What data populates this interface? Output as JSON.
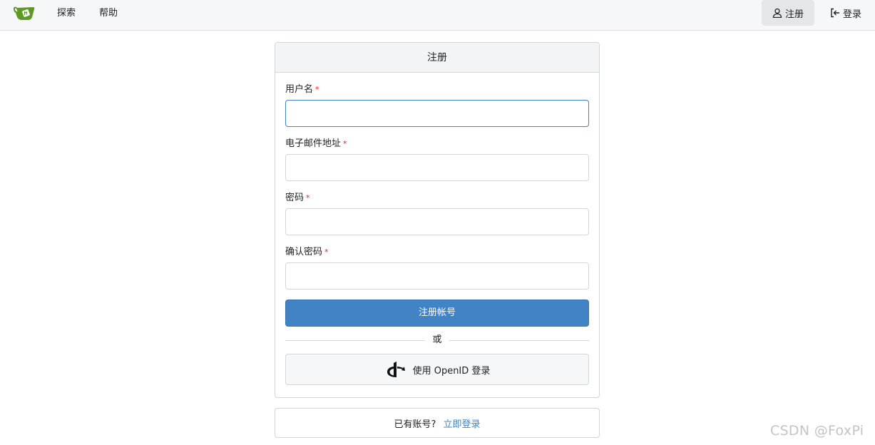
{
  "navbar": {
    "logo_icon": "gitea-tea-cup-icon",
    "explore_label": "探索",
    "help_label": "帮助",
    "register_label": "注册",
    "register_icon": "person-icon",
    "login_label": "登录",
    "login_icon": "sign-in-icon"
  },
  "form": {
    "title": "注册",
    "required_mark": "*",
    "fields": [
      {
        "label": "用户名",
        "value": "",
        "placeholder": ""
      },
      {
        "label": "电子邮件地址",
        "value": "",
        "placeholder": ""
      },
      {
        "label": "密码",
        "value": "",
        "placeholder": ""
      },
      {
        "label": "确认密码",
        "value": "",
        "placeholder": ""
      }
    ],
    "submit_label": "注册帐号",
    "divider_text": "或",
    "openid_label": "使用 OpenID 登录",
    "openid_icon": "openid-icon"
  },
  "footer": {
    "prompt": "已有账号?",
    "login_link": "立即登录"
  },
  "watermark": "CSDN @FoxPi",
  "colors": {
    "primary": "#4183c4",
    "required": "#db2828",
    "logo_green": "#609926"
  }
}
